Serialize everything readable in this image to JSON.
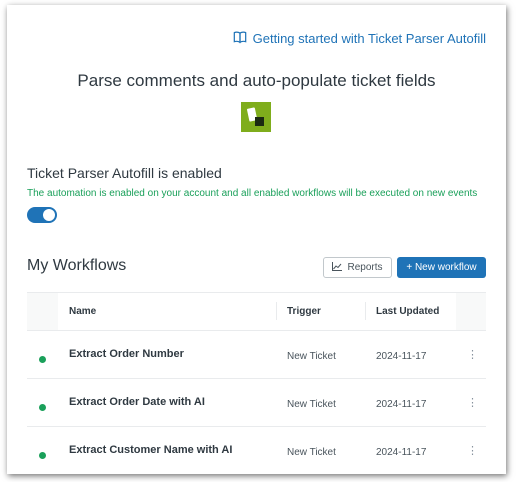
{
  "header": {
    "getting_started_link": "Getting started with Ticket Parser Autofill",
    "hero_title": "Parse comments and auto-populate ticket fields"
  },
  "status": {
    "title": "Ticket Parser Autofill is enabled",
    "description": "The automation is enabled on your account and all enabled workflows will be executed on new events",
    "enabled": true
  },
  "workflows": {
    "title": "My Workflows",
    "reports_label": "Reports",
    "new_workflow_label": "+ New workflow",
    "columns": {
      "name": "Name",
      "trigger": "Trigger",
      "last_updated": "Last Updated"
    },
    "rows": [
      {
        "name": "Extract Order Number",
        "trigger": "New Ticket",
        "last_updated": "2024-11-17",
        "menu": "⋮",
        "status_color": "#1aa05a"
      },
      {
        "name": "Extract Order Date with AI",
        "trigger": "New Ticket",
        "last_updated": "2024-11-17",
        "menu": "⋮",
        "status_color": "#1aa05a"
      },
      {
        "name": "Extract Customer Name with AI",
        "trigger": "New Ticket",
        "last_updated": "2024-11-17",
        "menu": "⋮",
        "status_color": "#1aa05a"
      }
    ]
  },
  "colors": {
    "accent": "#1f73b7",
    "success": "#1aa05a",
    "logo": "#7fad1c"
  },
  "icons": {
    "getting_started": "book-icon",
    "reports": "chart-icon",
    "logo": "app-logo"
  }
}
